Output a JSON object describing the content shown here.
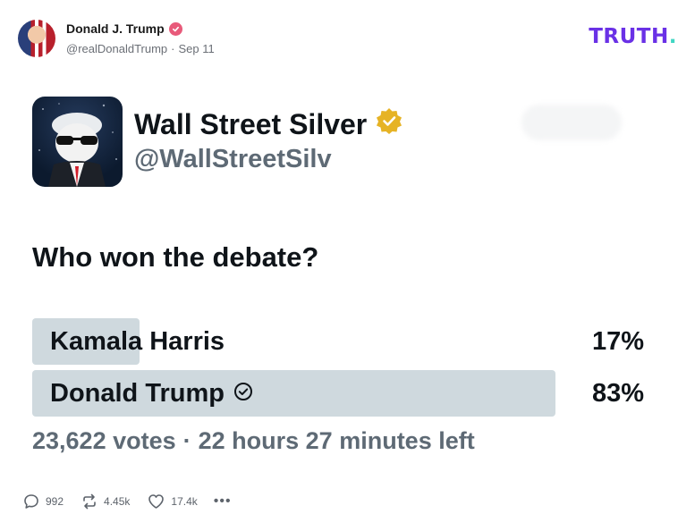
{
  "post": {
    "author_name": "Donald J. Trump",
    "handle": "@realDonaldTrump",
    "separator": "·",
    "date": "Sep 11",
    "brand": "TRUTH",
    "brand_dot": "."
  },
  "embed": {
    "name": "Wall Street Silver",
    "handle": "@WallStreetSilv",
    "question": "Who won the debate?",
    "poll": {
      "options": [
        {
          "label": "Kamala Harris",
          "percent": "17%",
          "fraction": 0.17,
          "winner": false
        },
        {
          "label": "Donald Trump",
          "percent": "83%",
          "fraction": 0.83,
          "winner": true
        }
      ],
      "votes": "23,622 votes",
      "meta_separator": "·",
      "time_left": "22 hours 27 minutes left"
    }
  },
  "actions": {
    "replies": "992",
    "retruths": "4.45k",
    "likes": "17.4k",
    "more": "•••"
  },
  "colors": {
    "brand": "#6a31e6",
    "brand_dot": "#41d6c3",
    "verified_badge": "#e85a7a",
    "poll_bar": "#cfd9de",
    "gold_badge": "#e6b325"
  },
  "icons": [
    "verified-badge-icon",
    "gold-verified-badge-icon",
    "check-circle-icon",
    "reply-icon",
    "retruth-icon",
    "heart-icon",
    "more-icon"
  ]
}
